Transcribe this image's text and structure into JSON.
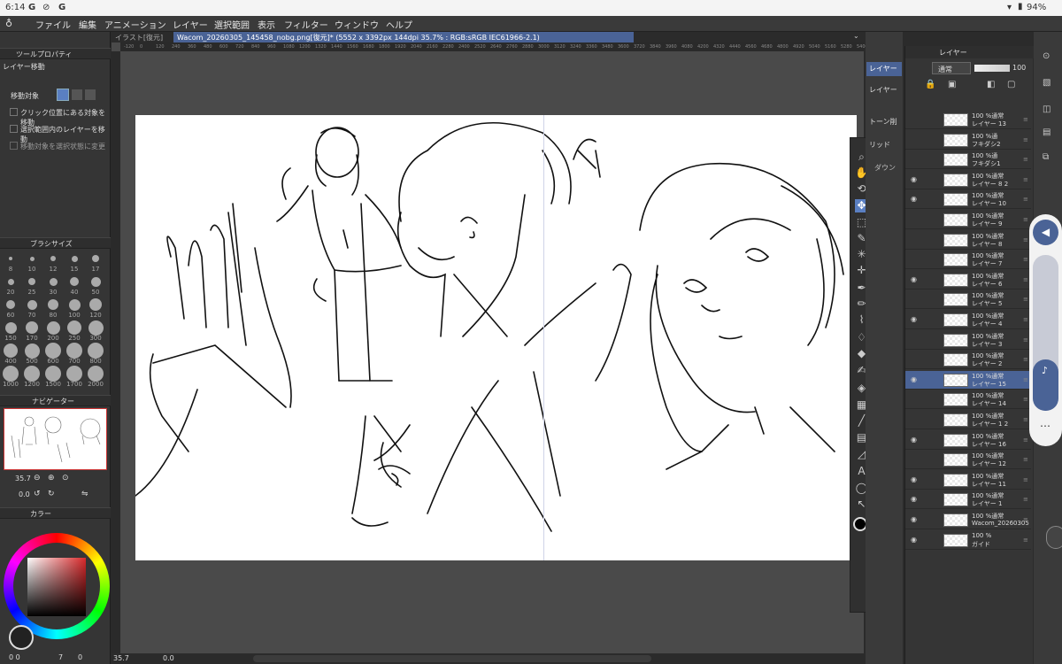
{
  "status": {
    "time": "6:14",
    "app_icons": [
      "G",
      "⊘",
      "G"
    ],
    "battery": "94%"
  },
  "menu": [
    "ファイル",
    "編集",
    "アニメーション",
    "レイヤー",
    "選択範囲",
    "表示",
    "フィルター",
    "ウィンドウ",
    "ヘルプ"
  ],
  "tabs": {
    "inactive": "イラスト[復元]",
    "active": "Wacom_20260305_145458_nobg.png[復元]* (5552 x 3392px 144dpi 35.7% : RGB:sRGB IEC61966-2.1)"
  },
  "ruler_ticks": [
    "-120",
    "0",
    "120",
    "240",
    "360",
    "480",
    "600",
    "720",
    "840",
    "960",
    "1080",
    "1200",
    "1320",
    "1440",
    "1560",
    "1680",
    "1800",
    "1920",
    "2040",
    "2160",
    "2280",
    "2400",
    "2520",
    "2640",
    "2760",
    "2880",
    "3000",
    "3120",
    "3240",
    "3360",
    "3480",
    "3600",
    "3720",
    "3840",
    "3960",
    "4080",
    "4200",
    "4320",
    "4440",
    "4560",
    "4680",
    "4800",
    "4920",
    "5040",
    "5160",
    "5280",
    "5400",
    "5520"
  ],
  "tool_property": {
    "title": "ツールプロパティ",
    "subtitle": "レイヤー移動",
    "target_label": "移動対象",
    "options": [
      "クリック位置にある対象を移動",
      "選択範囲内のレイヤーを移動",
      "移動対象を選択状態に変更"
    ]
  },
  "brush_size": {
    "title": "ブラシサイズ",
    "sizes": [
      "8",
      "10",
      "12",
      "15",
      "17",
      "20",
      "25",
      "30",
      "40",
      "50",
      "60",
      "70",
      "80",
      "100",
      "120",
      "150",
      "170",
      "200",
      "250",
      "300",
      "400",
      "500",
      "600",
      "700",
      "800",
      "1000",
      "1200",
      "1500",
      "1700",
      "2000"
    ]
  },
  "navigator": {
    "title": "ナビゲーター",
    "zoom": "35.7",
    "rotate": "0.0"
  },
  "color": {
    "title": "カラー",
    "bottom": [
      "0 0",
      "7",
      "0"
    ]
  },
  "bottom_bar": {
    "zoom": "35.7",
    "angle": "0.0"
  },
  "subtools": [
    "レイヤー",
    "トーン削",
    "リッド",
    "ダウン"
  ],
  "layers": {
    "title": "レイヤー",
    "blend": "通常",
    "opacity": "100",
    "rows": [
      {
        "pct": "100 %通常",
        "name": "レイヤー 13",
        "eye": false
      },
      {
        "pct": "100 %通",
        "name": "フキダシ2",
        "eye": false
      },
      {
        "pct": "100 %通",
        "name": "フキダシ1",
        "eye": false
      },
      {
        "pct": "100 %通常",
        "name": "レイヤー 8 2",
        "eye": true
      },
      {
        "pct": "100 %通常",
        "name": "レイヤー 10",
        "eye": true
      },
      {
        "pct": "100 %通常",
        "name": "レイヤー 9",
        "eye": false
      },
      {
        "pct": "100 %通常",
        "name": "レイヤー 8",
        "eye": false
      },
      {
        "pct": "100 %通常",
        "name": "レイヤー 7",
        "eye": false
      },
      {
        "pct": "100 %通常",
        "name": "レイヤー 6",
        "eye": true
      },
      {
        "pct": "100 %通常",
        "name": "レイヤー 5",
        "eye": false
      },
      {
        "pct": "100 %通常",
        "name": "レイヤー 4",
        "eye": true
      },
      {
        "pct": "100 %通常",
        "name": "レイヤー 3",
        "eye": false
      },
      {
        "pct": "100 %通常",
        "name": "レイヤー 2",
        "eye": false
      },
      {
        "pct": "100 %通常",
        "name": "レイヤー 15",
        "eye": true
      },
      {
        "pct": "100 %通常",
        "name": "レイヤー 14",
        "eye": false
      },
      {
        "pct": "100 %通常",
        "name": "レイヤー 1 2",
        "eye": false
      },
      {
        "pct": "100 %通常",
        "name": "レイヤー 16",
        "eye": true
      },
      {
        "pct": "100 %通常",
        "name": "レイヤー 12",
        "eye": false
      },
      {
        "pct": "100 %通常",
        "name": "レイヤー 11",
        "eye": true
      },
      {
        "pct": "100 %通常",
        "name": "レイヤー 1",
        "eye": true
      },
      {
        "pct": "100 %通常",
        "name": "Wacom_20260305",
        "eye": true
      },
      {
        "pct": "100 %",
        "name": "ガイド",
        "eye": true
      }
    ]
  },
  "colors": {
    "accent": "#5a7fc2",
    "selected": "#4a6396"
  }
}
